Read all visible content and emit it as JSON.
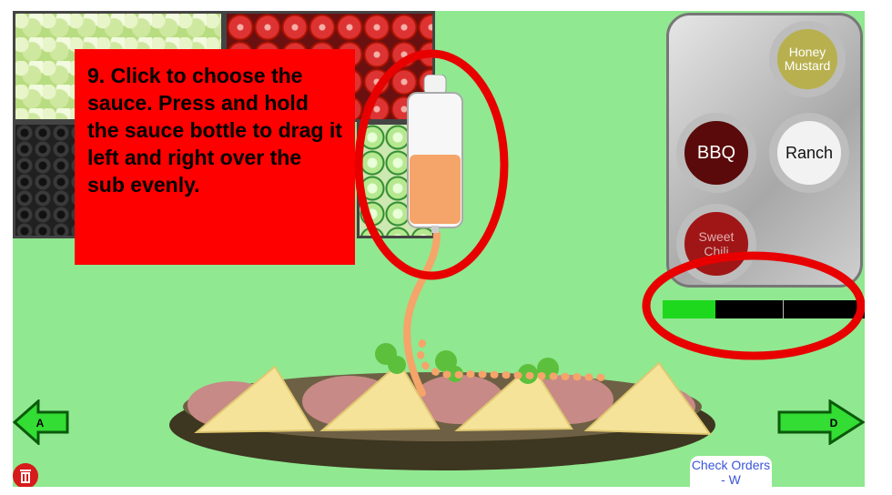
{
  "instruction": {
    "text": "9. Click to choose the sauce. Press and hold the sauce bottle to drag it left and right over the sub evenly."
  },
  "sauces": [
    {
      "label": "Honey Mustard",
      "color": "#b8b04e",
      "text_color": "#ffffff"
    },
    {
      "label": "BBQ",
      "color": "#5a0a0a",
      "text_color": "#ffffff"
    },
    {
      "label": "Ranch",
      "color": "#f2f2f2",
      "text_color": "#111111"
    },
    {
      "label": "Sweet Chili",
      "color": "#a01616",
      "text_color": "#e0b0b0"
    }
  ],
  "progress": {
    "fraction": 0.26,
    "segments": 3,
    "fill_color": "#1ed81e"
  },
  "nav": {
    "left_key": "A",
    "right_key": "D"
  },
  "check_orders": {
    "label": "Check Orders - W"
  },
  "icons": {
    "trash": "trash-icon",
    "bottle": "sauce-bottle-icon"
  },
  "highlight_color": "#e80000",
  "sauce_color": "#f5a46a"
}
